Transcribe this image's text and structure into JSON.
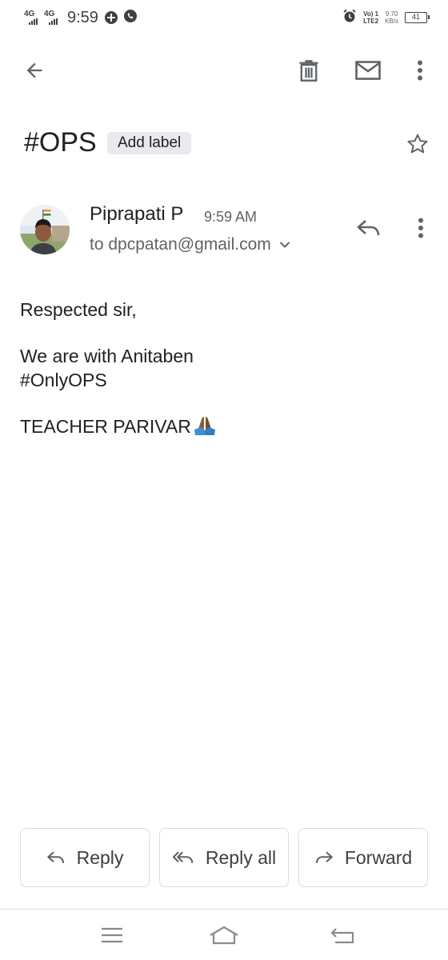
{
  "status_bar": {
    "network_1": "4G",
    "network_2": "4G",
    "time": "9:59",
    "volte_line1": "Vo) 1",
    "volte_line2": "LTE2",
    "speed_value": "9.70",
    "speed_unit": "KB/s",
    "battery": "41"
  },
  "toolbar": {
    "icons": [
      "back-arrow-icon",
      "trash-icon",
      "mail-icon",
      "more-vert-icon"
    ]
  },
  "subject": {
    "title": "#OPS",
    "label_chip": "Add label"
  },
  "sender": {
    "name": "Piprapati P",
    "time": "9:59 AM",
    "to": "to dpcpatan@gmail.com"
  },
  "body": {
    "line1": "Respected sir,",
    "line2": "We are with Anitaben",
    "line3": "#OnlyOPS",
    "line4": "TEACHER PARIVAR"
  },
  "actions": {
    "reply": "Reply",
    "reply_all": "Reply all",
    "forward": "Forward"
  },
  "colors": {
    "text_primary": "#202124",
    "text_secondary": "#5f6368",
    "icon": "#5f6368",
    "chip_bg": "#e8eaed",
    "button_border": "#dadce0"
  }
}
